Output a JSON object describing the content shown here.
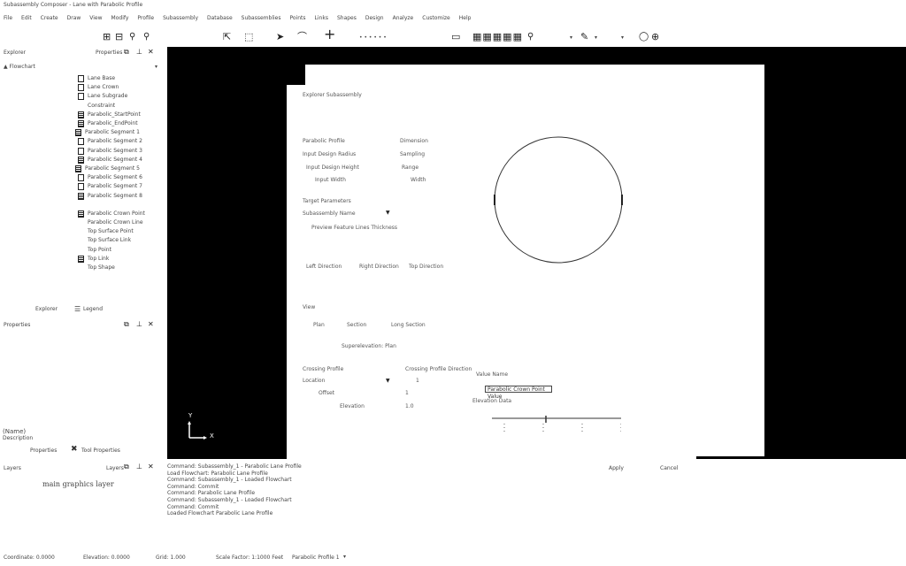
{
  "window": {
    "title": "Subassembly Composer - Lane with Parabolic Profile"
  },
  "menu": [
    "File",
    "Edit",
    "Create",
    "Draw",
    "View",
    "Modify",
    "Profile",
    "Subassembly",
    "Database",
    "Subassemblies",
    "Points",
    "Links",
    "Shapes",
    "Design",
    "Analyze",
    "Customize",
    "Help"
  ],
  "toolbar": {
    "zoom_extents": "⊞",
    "zoom_window": "⊟",
    "zoom": "🔍",
    "zoom_prev": "🔍",
    "select": "⇱",
    "window_sel": "⬚",
    "arc": "⌒",
    "cross": "+",
    "point_dots": "•  •  •  •  •  •",
    "rect": "▭",
    "hatch": "▦▦▦▦▦",
    "bulb": "💡",
    "cube": "⊕"
  },
  "panels": {
    "explorer": {
      "title": "Explorer",
      "tab_right": "Properties",
      "root": "▲ Flowchart"
    },
    "tree": [
      {
        "icon": "file",
        "label": "Lane Base"
      },
      {
        "icon": "file",
        "label": "Lane Crown"
      },
      {
        "icon": "file",
        "label": "Lane Subgrade"
      },
      {
        "icon": "none",
        "label": "Constraint"
      },
      {
        "icon": "lines",
        "label": "Parabolic_StartPoint"
      },
      {
        "icon": "lines",
        "label": "Parabolic_EndPoint"
      },
      {
        "icon": "node",
        "label": "Parabolic Segment 1"
      },
      {
        "icon": "file",
        "label": "Parabolic Segment 2"
      },
      {
        "icon": "file",
        "label": "Parabolic Segment 3"
      },
      {
        "icon": "lines",
        "label": "Parabolic Segment 4"
      },
      {
        "icon": "node",
        "label": "Parabolic Segment 5"
      },
      {
        "icon": "file",
        "label": "Parabolic Segment 6"
      },
      {
        "icon": "file",
        "label": "Parabolic Segment 7"
      },
      {
        "icon": "lines",
        "label": "Parabolic Segment 8"
      },
      {
        "icon": "none",
        "label": ""
      },
      {
        "icon": "lines",
        "label": "Parabolic Crown Point"
      },
      {
        "icon": "none",
        "label": "Parabolic Crown Line"
      },
      {
        "icon": "none",
        "label": "Top Surface Point"
      },
      {
        "icon": "none",
        "label": "Top Surface Link"
      },
      {
        "icon": "none",
        "label": "Top Point"
      },
      {
        "icon": "lines",
        "label": "Top Link"
      },
      {
        "icon": "none",
        "label": "Top Shape"
      }
    ],
    "tabs": {
      "explorer": "Explorer",
      "legend": "Legend"
    },
    "properties": {
      "title": "Properties",
      "name": "(Name)",
      "description": "Description",
      "footer_props": "Properties",
      "footer_tool": "Tool Properties"
    },
    "layers": {
      "title": "Layers",
      "tab_right": "Layers",
      "item": "main graphics layer"
    }
  },
  "dialog": {
    "title": "Explorer Subassembly",
    "params": [
      [
        "Parabolic Profile",
        "Dimension"
      ],
      [
        "Input Design Radius",
        "Sampling"
      ],
      [
        "Input Design Height",
        "Range"
      ],
      [
        "Input Width",
        "Width"
      ]
    ],
    "section_label": "Target Parameters",
    "target_select": "Subassembly Name",
    "checks": "Preview  Feature Lines  Thickness",
    "options": [
      "Left Direction",
      "Right Direction",
      "Top Direction"
    ],
    "view_label": "View",
    "view_modes": [
      "Plan",
      "Section",
      "Long Section"
    ],
    "detail": "Superelevation: Plan",
    "lower": {
      "left1": "Crossing Profile",
      "left2": "Location",
      "left3": "Offset",
      "left4": "Elevation",
      "right_head": "Crossing Profile Direction",
      "right1": "1",
      "right2": "1",
      "right3": "1.0",
      "side_label": "Value Name",
      "selected": "Parabolic Crown Point Value",
      "side_label2": "Elevation Data"
    }
  },
  "axis": {
    "x": "X",
    "y": "Y"
  },
  "buttons": {
    "ok": "Apply",
    "cancel": "Cancel"
  },
  "command_history": [
    "Command: Subassembly_1 - Parabolic Lane Profile",
    "Load Flowchart: Parabolic Lane Profile",
    "Command: Subassembly_1 - Loaded Flowchart",
    "Command: Commit",
    "Command: Parabolic Lane Profile",
    "Command: Subassembly_1 - Loaded Flowchart",
    "Command: Commit",
    "Loaded Flowchart Parabolic Lane Profile"
  ],
  "status": {
    "coords": "Coordinate: 0.0000",
    "ortho": "Elevation: 0.0000",
    "grid": "Grid: 1.000",
    "scale": "Scale Factor: 1:1000 Feet",
    "layout": "Parabolic Profile 1",
    "layout_arrow": "▾"
  }
}
